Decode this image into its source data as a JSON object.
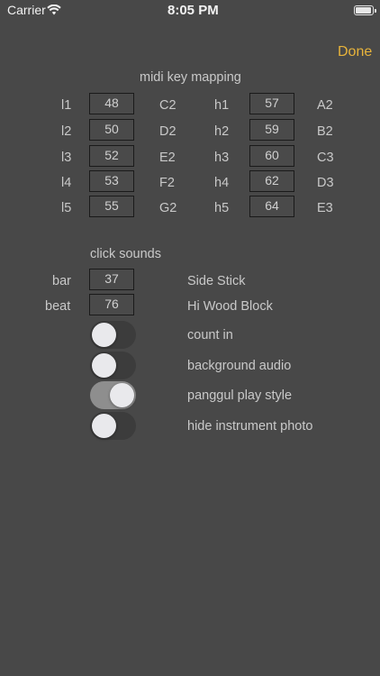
{
  "status_bar": {
    "carrier": "Carrier",
    "time": "8:05 PM"
  },
  "header": {
    "done_label": "Done"
  },
  "midi": {
    "title": "midi key mapping",
    "rows": [
      {
        "low_label": "l1",
        "low_value": "48",
        "low_note": "C2",
        "high_label": "h1",
        "high_value": "57",
        "high_note": "A2"
      },
      {
        "low_label": "l2",
        "low_value": "50",
        "low_note": "D2",
        "high_label": "h2",
        "high_value": "59",
        "high_note": "B2"
      },
      {
        "low_label": "l3",
        "low_value": "52",
        "low_note": "E2",
        "high_label": "h3",
        "high_value": "60",
        "high_note": "C3"
      },
      {
        "low_label": "l4",
        "low_value": "53",
        "low_note": "F2",
        "high_label": "h4",
        "high_value": "62",
        "high_note": "D3"
      },
      {
        "low_label": "l5",
        "low_value": "55",
        "low_note": "G2",
        "high_label": "h5",
        "high_value": "64",
        "high_note": "E3"
      }
    ]
  },
  "click": {
    "title": "click sounds",
    "bar_label": "bar",
    "bar_value": "37",
    "bar_sound": "Side Stick",
    "beat_label": "beat",
    "beat_value": "76",
    "beat_sound": "Hi Wood Block"
  },
  "toggles": [
    {
      "label": "count in",
      "on": false
    },
    {
      "label": "background audio",
      "on": false
    },
    {
      "label": "panggul play style",
      "on": true
    },
    {
      "label": "hide instrument photo",
      "on": false
    }
  ]
}
